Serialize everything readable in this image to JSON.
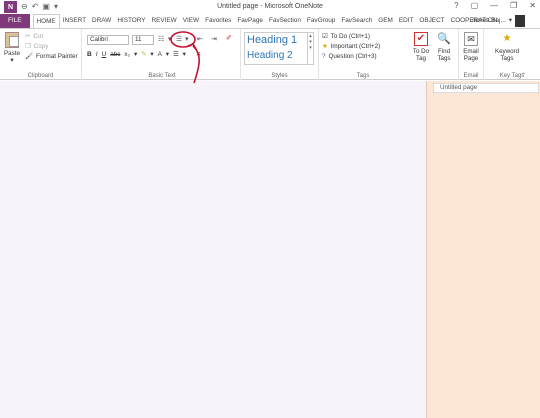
{
  "window": {
    "title": "Untitled page - Microsoft OneNote",
    "app_icon_text": "N",
    "controls": [
      "?",
      "▢",
      "—",
      "❐",
      "✕"
    ]
  },
  "tabs": [
    "FILE",
    "HOME",
    "INSERT",
    "DRAW",
    "HISTORY",
    "REVIEW",
    "VIEW",
    "Favorites",
    "FavPage",
    "FavSection",
    "FavGroup",
    "FavSearch",
    "GEM",
    "EDIT",
    "OBJECT",
    "COOPERATION"
  ],
  "active_tab": "HOME",
  "user": {
    "name": "James Baj..."
  },
  "clipboard": {
    "paste": "Paste",
    "cut": "Cut",
    "copy": "Copy",
    "format_painter": "Format Painter",
    "label": "Clipboard"
  },
  "basic_text": {
    "font": "Calibri",
    "size": "11",
    "bold": "B",
    "italic": "I",
    "underline": "U",
    "strike": "abc",
    "subscript": "x₂",
    "label": "Basic Text"
  },
  "styles": {
    "heading1": "Heading 1",
    "heading2": "Heading 2",
    "label": "Styles"
  },
  "tags": {
    "items": [
      "To Do (Ctrl+1)",
      "Important (Ctrl+2)",
      "Question (Ctrl+3)"
    ],
    "label": "Tags",
    "todo_tag": "To Do Tag",
    "find_tags": "Find Tags"
  },
  "email": {
    "button": "Email Page",
    "label": "Email"
  },
  "key_tags": {
    "button": "Keyword Tags",
    "label": "Key Tags"
  },
  "pages": [
    "Untitled page"
  ],
  "colors": {
    "accent": "#80397b",
    "canvas": "#f8f2fb",
    "page_panel": "#fce7d6",
    "annotation": "#c8102e"
  }
}
